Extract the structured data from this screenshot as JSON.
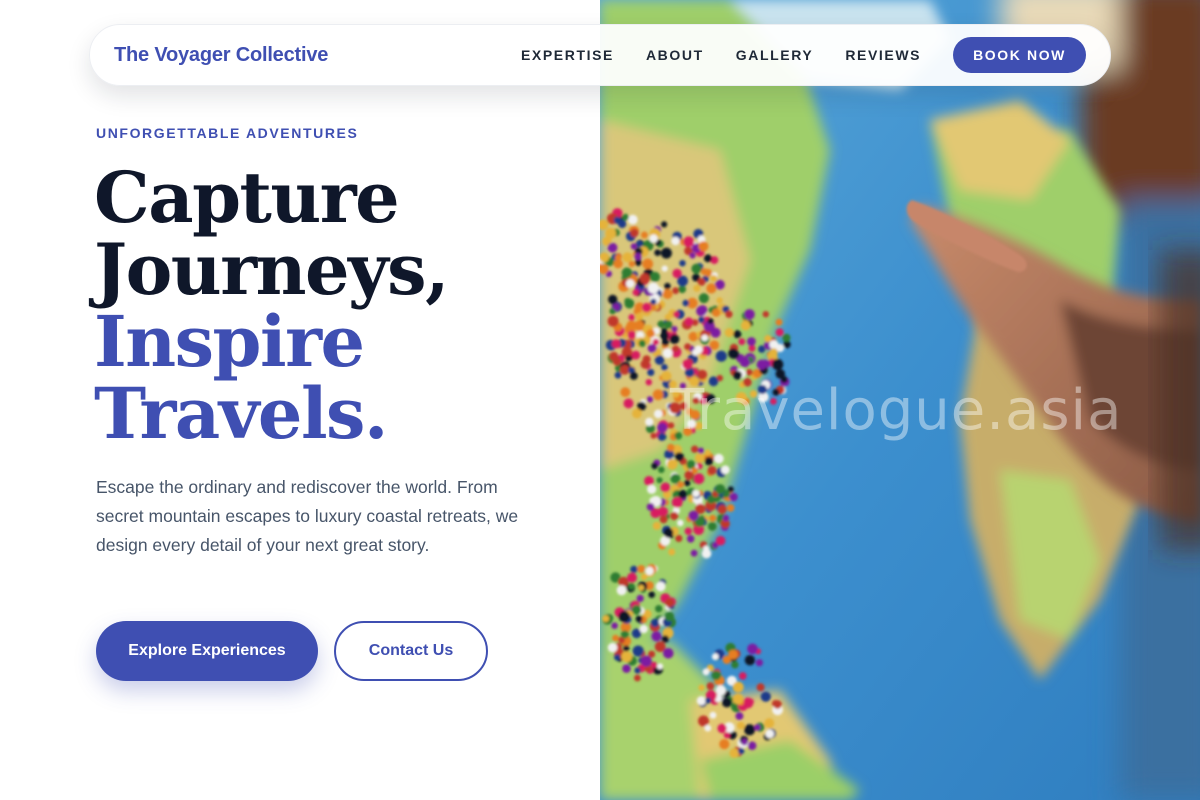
{
  "nav": {
    "brand": "The Voyager Collective",
    "links": [
      "EXPERTISE",
      "ABOUT",
      "GALLERY",
      "REVIEWS"
    ],
    "cta": "BOOK NOW"
  },
  "hero": {
    "eyebrow": "UNFORGETTABLE ADVENTURES",
    "headline_dark_1": "Capture",
    "headline_dark_2": "Journeys,",
    "headline_accent_1": "Inspire",
    "headline_accent_2": "Travels.",
    "lead": "Escape the ordinary and rediscover the world. From secret mountain escapes to luxury coastal retreats, we design every detail of your next great story.",
    "primary_button": "Explore Experiences",
    "secondary_button": "Contact Us"
  },
  "photo": {
    "watermark": "Travelogue.asia"
  },
  "colors": {
    "accent": "#3f4fb2",
    "heading": "#0f172a",
    "body_text": "#475569"
  }
}
